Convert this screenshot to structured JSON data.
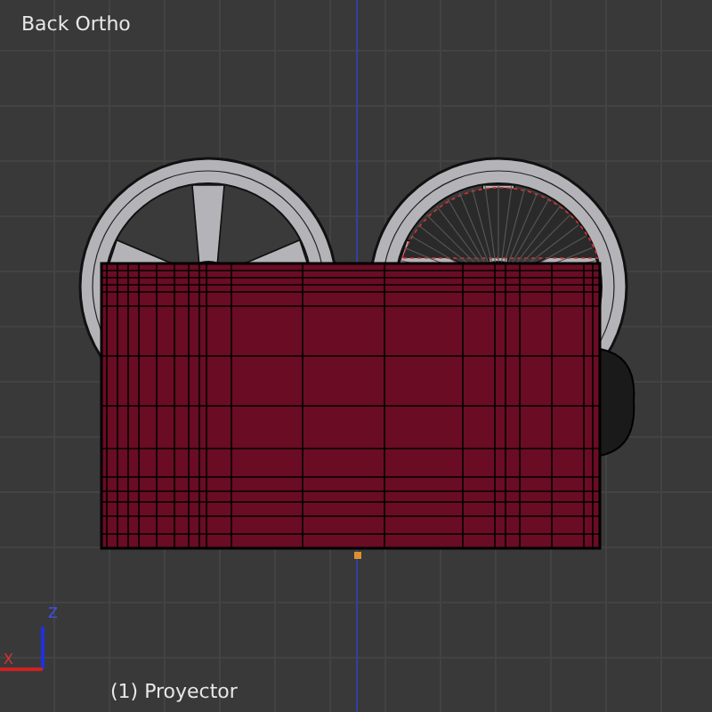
{
  "viewport": {
    "view_name": "Back Ortho",
    "object_name": "(1) Proyector"
  },
  "axis_gizmo": {
    "x_label": "X",
    "z_label": "Z"
  }
}
